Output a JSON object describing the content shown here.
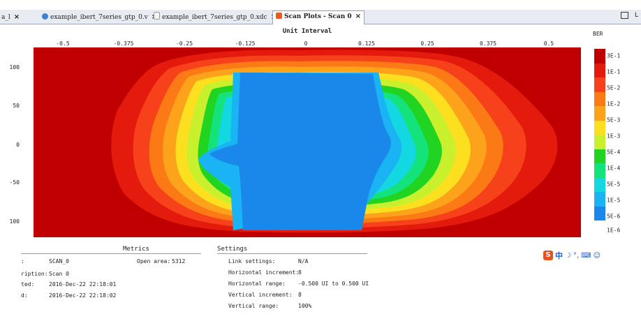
{
  "tabs": [
    {
      "label": "a_l",
      "close": "×",
      "icon": "none",
      "active": false
    },
    {
      "label": "example_ibert_7series_gtp_0.v",
      "close": "×",
      "icon": "verilog-file-icon",
      "active": false
    },
    {
      "label": "example_ibert_7series_gtp_0.xdc",
      "close": "×",
      "icon": "constraints-file-icon",
      "active": false
    },
    {
      "label": "Scan Plots - Scan 0",
      "close": "×",
      "icon": "scan-plot-icon",
      "active": true
    }
  ],
  "window_right_label": "L",
  "plot": {
    "x_axis_title": "Unit Interval",
    "x_ticks": [
      "-0.5",
      "-0.375",
      "-0.25",
      "-0.125",
      "0",
      "0.125",
      "0.25",
      "0.375",
      "0.5"
    ],
    "y_ticks": [
      "100",
      "50",
      "0",
      "-50",
      "100"
    ],
    "legend_title": "BER",
    "legend_labels": [
      "3E-1",
      "1E-1",
      "5E-2",
      "1E-2",
      "5E-3",
      "1E-3",
      "5E-4",
      "1E-4",
      "5E-5",
      "1E-5",
      "5E-6",
      "1E-6"
    ],
    "legend_colors": [
      "#c00000",
      "#e31a0c",
      "#f6411a",
      "#fb7a15",
      "#fca21b",
      "#fce020",
      "#c9f02d",
      "#22d422",
      "#14e27a",
      "#13d8e2",
      "#1ab3f3",
      "#1a88ea"
    ]
  },
  "chart_data": {
    "type": "heatmap",
    "title": "Unit Interval",
    "xlabel": "Unit Interval",
    "ylabel": "",
    "xlim": [
      -0.5,
      0.5
    ],
    "ylim": [
      -127,
      127
    ],
    "x_ticks": [
      -0.5,
      -0.375,
      -0.25,
      -0.125,
      0,
      0.125,
      0.25,
      0.375,
      0.5
    ],
    "y_ticks": [
      100,
      50,
      0,
      -50,
      -100
    ],
    "open_area": 5312
  },
  "scan_info": {
    "rows": [
      {
        "label": ":",
        "value": "SCAN_0"
      },
      {
        "label": "ription:",
        "value": "Scan 0"
      },
      {
        "label": "ted:",
        "value": "2016-Dec-22 22:18:01"
      },
      {
        "label": "d:",
        "value": "2016-Dec-22 22:18:02"
      }
    ]
  },
  "metrics": {
    "heading": "Metrics",
    "open_area_label": "Open area:",
    "open_area_value": "5312"
  },
  "settings": {
    "heading": "Settings",
    "rows": [
      {
        "label": "Link settings:",
        "value": "N/A"
      },
      {
        "label": "Horizontal increment:",
        "value": "8"
      },
      {
        "label": "Horizontal range:",
        "value": "-0.500 UI to 0.500 UI"
      },
      {
        "label": "Vertical increment:",
        "value": "8"
      },
      {
        "label": "Vertical range:",
        "value": "100%"
      }
    ]
  },
  "ime": {
    "s": "S",
    "zh": "中"
  }
}
